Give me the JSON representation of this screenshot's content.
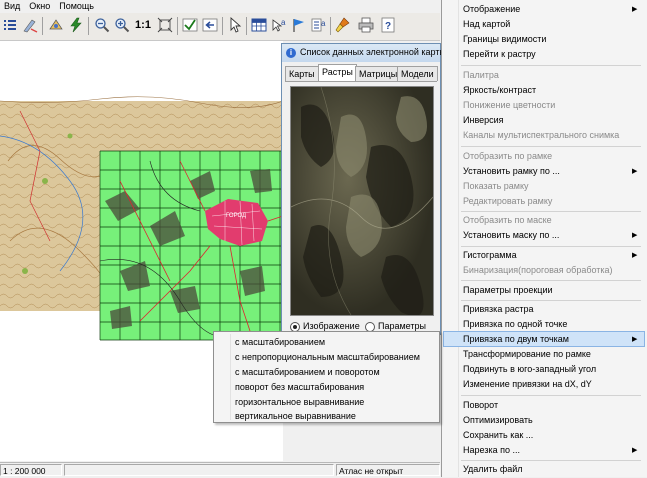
{
  "menubar": {
    "items": [
      "Вид",
      "Окно",
      "Помощь"
    ]
  },
  "toolbar": {
    "scale_label": "1:1"
  },
  "dialog": {
    "title": "Список данных электронной карты",
    "tabs": [
      "Карты",
      "Растры",
      "Матрицы",
      "Модели"
    ],
    "active_tab": "Растры",
    "radio_image": "Изображение",
    "radio_params": "Параметры"
  },
  "statusbar": {
    "scale": "1 : 200 000",
    "atlas": "Атлас не открыт"
  },
  "context_menu": {
    "items": [
      {
        "label": "Отображение",
        "disabled": false,
        "submenu": true
      },
      {
        "label": "Над картой",
        "disabled": false
      },
      {
        "label": "Границы видимости",
        "disabled": false
      },
      {
        "label": "Перейти к растру",
        "disabled": false
      },
      {
        "label": "Палитра",
        "disabled": true
      },
      {
        "label": "Яркость/контраст",
        "disabled": false
      },
      {
        "label": "Понижение цветности",
        "disabled": true
      },
      {
        "label": "Инверсия",
        "disabled": false
      },
      {
        "label": "Каналы мультиспектрального снимка",
        "disabled": true
      },
      {
        "label": "Отобразить по рамке",
        "disabled": true
      },
      {
        "label": "Установить рамку по ...",
        "disabled": false,
        "submenu": true
      },
      {
        "label": "Показать рамку",
        "disabled": true
      },
      {
        "label": "Редактировать рамку",
        "disabled": true
      },
      {
        "label": "Отобразить по маске",
        "disabled": true
      },
      {
        "label": "Установить маску по ...",
        "disabled": false,
        "submenu": true
      },
      {
        "label": "Гистограмма",
        "disabled": false,
        "submenu": true
      },
      {
        "label": "Бинаризация(пороговая обработка)",
        "disabled": true
      },
      {
        "label": "Параметры проекции",
        "disabled": false
      },
      {
        "label": "Привязка растра",
        "disabled": false
      },
      {
        "label": "Привязка по одной точке",
        "disabled": false
      },
      {
        "label": "Привязка по двум точкам",
        "disabled": false,
        "submenu": true,
        "highlighted": true
      },
      {
        "label": "Трансформирование по рамке",
        "disabled": false
      },
      {
        "label": "Подвинуть в юго-западный угол",
        "disabled": false
      },
      {
        "label": "Изменение привязки на dX, dY",
        "disabled": false
      },
      {
        "label": "Поворот",
        "disabled": false
      },
      {
        "label": "Оптимизировать",
        "disabled": false
      },
      {
        "label": "Сохранить как ...",
        "disabled": false
      },
      {
        "label": "Нарезка по ...",
        "disabled": false,
        "submenu": true
      },
      {
        "label": "Удалить файл",
        "disabled": false
      }
    ]
  },
  "submenu": {
    "items": [
      "с масштабированием",
      "с непропорциональным масштабированием",
      "с масштабированием и поворотом",
      "поворот без масштабирования",
      "горизонтальное выравнивание",
      "вертикальное выравнивание"
    ]
  },
  "map_label": "ГОРОД",
  "colors": {
    "overlay_green": "#77f07a",
    "highlight": "#cfe3f8",
    "topo_bg": "#d9c59a",
    "urban": "#e23c6e"
  }
}
